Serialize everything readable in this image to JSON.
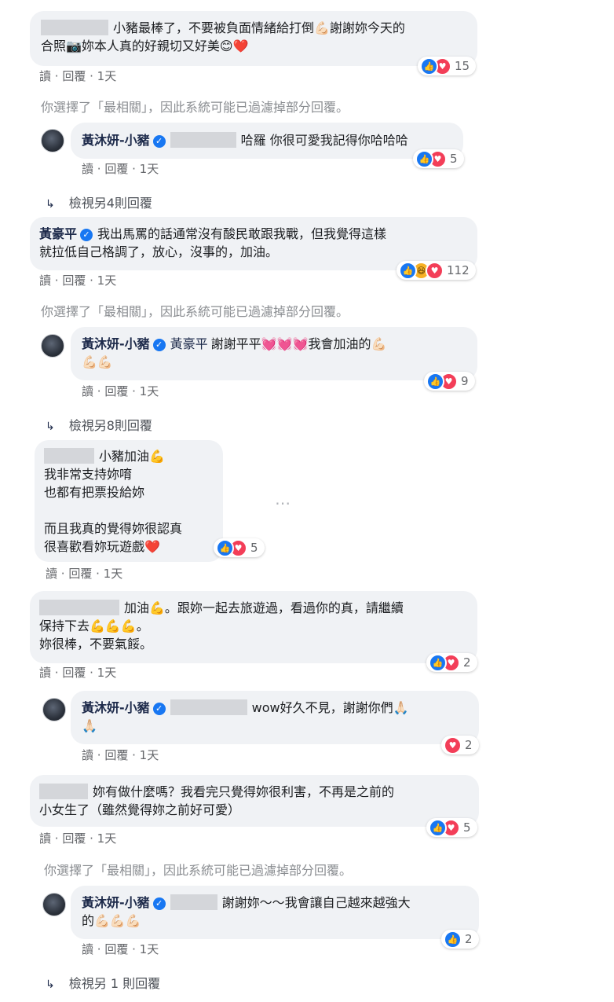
{
  "meta_labels": {
    "read": "讀",
    "reply": "回覆",
    "sep": "·"
  },
  "colors": {
    "like": "#1877f2",
    "love": "#f33e58",
    "haha": "#f7b125",
    "bubble": "#f0f2f5"
  },
  "icons": {
    "like": "like-icon",
    "love": "love-icon",
    "haha": "haha-icon",
    "verified": "verified-badge-icon",
    "reply_arrow": "reply-arrow-icon",
    "more": "more-options-icon"
  },
  "c1": {
    "text": "小豬最棒了，不要被負面情緒給打倒💪🏻謝謝妳今天的\n合照📷妳本人真的好親切又好美😊❤️",
    "count": "15",
    "time": "1天"
  },
  "notice1": "你選擇了「最相關」，因此系統可能已過濾掉部分回覆。",
  "r1": {
    "author": "黃沐妍-小豬",
    "text": "哈羅 你很可愛我記得你哈哈哈",
    "count": "5",
    "time": "1天"
  },
  "more1": "檢視另4則回覆",
  "c2": {
    "author": "黃豪平",
    "text": "我出馬罵的話通常沒有酸民敢跟我戰，但我覺得這樣\n就拉低自己格調了，放心，沒事的，加油。",
    "count": "112",
    "time": "1天"
  },
  "notice2": "你選擇了「最相關」，因此系統可能已過濾掉部分回覆。",
  "r2": {
    "author": "黃沐妍-小豬",
    "tag": "黃豪平",
    "text": "謝謝平平💓💓💓我會加油的💪🏻\n💪🏻💪🏻",
    "count": "9",
    "time": "1天"
  },
  "more2": "檢視另8則回覆",
  "c3": {
    "text": "小豬加油💪\n我非常支持妳唷\n也都有把票投給妳\n\n而且我真的覺得妳很認真\n很喜歡看妳玩遊戲❤️",
    "count": "5",
    "time": "1天"
  },
  "c4": {
    "text": "加油💪。跟妳一起去旅遊過，看過你的真，請繼續\n保持下去💪💪💪。\n妳很棒，不要氣餒。",
    "count": "2",
    "time": "1天"
  },
  "r4": {
    "author": "黃沐妍-小豬",
    "text": "wow好久不見，謝謝你們🙏🏻\n🙏🏻",
    "count": "2",
    "time": "1天"
  },
  "c5": {
    "text": "妳有做什麼嗎？我看完只覺得妳很利害，不再是之前的\n小女生了（雖然覺得妳之前好可愛）",
    "count": "5",
    "time": "1天"
  },
  "notice3": "你選擇了「最相關」，因此系統可能已過濾掉部分回覆。",
  "r5": {
    "author": "黃沐妍-小豬",
    "text": "謝謝妳～～我會讓自己越來越強大\n的💪🏻💪🏻💪🏻",
    "count": "2",
    "time": "1天"
  },
  "more3": "檢視另 1 則回覆"
}
